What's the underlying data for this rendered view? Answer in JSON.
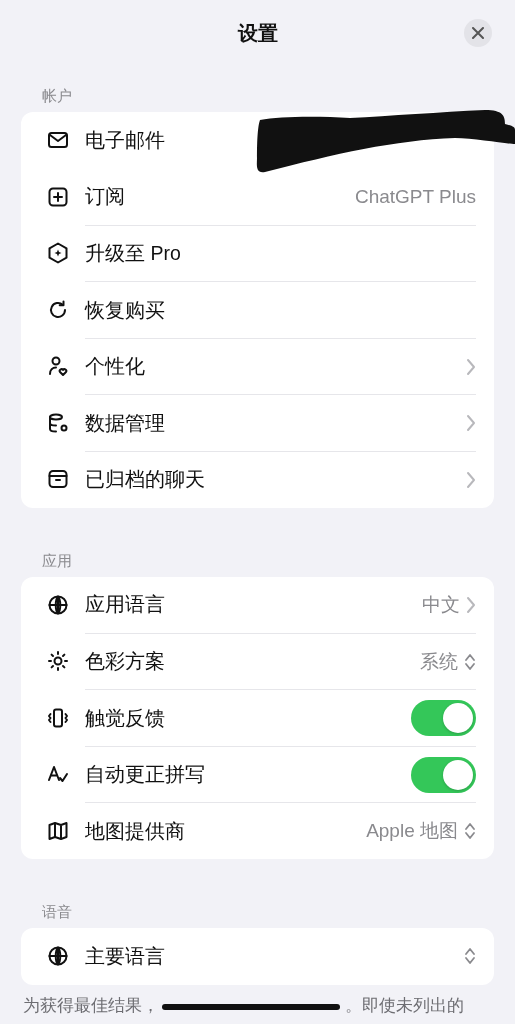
{
  "title": "设置",
  "sections": [
    {
      "header": "帐户",
      "rows": [
        {
          "label": "电子邮件",
          "kind": "plain",
          "value_redacted": true
        },
        {
          "label": "订阅",
          "value": "ChatGPT Plus",
          "kind": "plain"
        },
        {
          "label": "升级至 Pro",
          "kind": "plain"
        },
        {
          "label": "恢复购买",
          "kind": "plain"
        },
        {
          "label": "个性化",
          "kind": "chevron"
        },
        {
          "label": "数据管理",
          "kind": "chevron"
        },
        {
          "label": "已归档的聊天",
          "kind": "chevron"
        }
      ]
    },
    {
      "header": "应用",
      "rows": [
        {
          "label": "应用语言",
          "value": "中文",
          "kind": "chevron"
        },
        {
          "label": "色彩方案",
          "value": "系统",
          "kind": "updown"
        },
        {
          "label": "触觉反馈",
          "kind": "toggle",
          "on": true
        },
        {
          "label": "自动更正拼写",
          "kind": "toggle",
          "on": true
        },
        {
          "label": "地图提供商",
          "value": "Apple 地图",
          "kind": "updown"
        }
      ]
    },
    {
      "header": "语音",
      "rows": [
        {
          "label": "主要语言",
          "kind": "updown"
        }
      ],
      "footnote": [
        "为获得最佳结果，",
        "。即使未列出的"
      ]
    }
  ]
}
